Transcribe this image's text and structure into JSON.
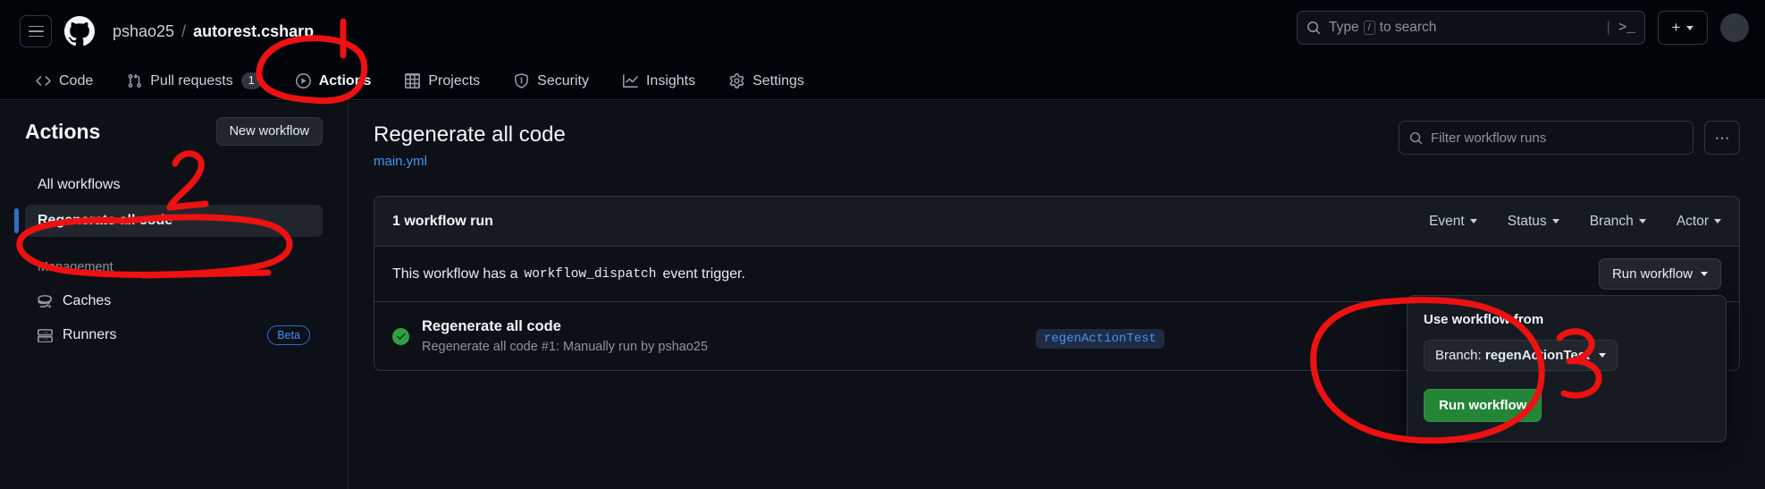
{
  "header": {
    "menu_icon": "hamburger-icon",
    "logo_icon": "github-logo-icon",
    "owner": "pshao25",
    "separator": "/",
    "repo": "autorest.csharp",
    "search_placeholder": "Type",
    "search_key": "/",
    "search_suffix": "to search",
    "terminal_icon": "terminal-icon",
    "plus_label": "+",
    "avatar": "user-avatar"
  },
  "repo_nav": [
    {
      "label": "Code",
      "icon": "code-icon",
      "active": false,
      "count": null
    },
    {
      "label": "Pull requests",
      "icon": "git-pull-request-icon",
      "active": false,
      "count": "1"
    },
    {
      "label": "Actions",
      "icon": "play-circle-icon",
      "active": true,
      "count": null
    },
    {
      "label": "Projects",
      "icon": "table-icon",
      "active": false,
      "count": null
    },
    {
      "label": "Security",
      "icon": "shield-icon",
      "active": false,
      "count": null
    },
    {
      "label": "Insights",
      "icon": "graph-icon",
      "active": false,
      "count": null
    },
    {
      "label": "Settings",
      "icon": "gear-icon",
      "active": false,
      "count": null
    }
  ],
  "sidebar": {
    "title": "Actions",
    "new_workflow_label": "New workflow",
    "all_workflows_label": "All workflows",
    "selected_workflow_label": "Regenerate all code",
    "management_label": "Management",
    "caches_label": "Caches",
    "caches_icon": "cache-icon",
    "runners_label": "Runners",
    "runners_icon": "server-icon",
    "runners_badge": "Beta"
  },
  "main": {
    "workflow_title": "Regenerate all code",
    "workflow_file": "main.yml",
    "filter_placeholder": "Filter workflow runs",
    "search_icon": "search-icon",
    "more_options_label": "···",
    "runs_count_label": "1 workflow run",
    "filters": [
      {
        "label": "Event"
      },
      {
        "label": "Status"
      },
      {
        "label": "Branch"
      },
      {
        "label": "Actor"
      }
    ],
    "dispatch_prefix": "This workflow has a",
    "dispatch_code": "workflow_dispatch",
    "dispatch_suffix": "event trigger.",
    "run_workflow_button": "Run workflow",
    "run": {
      "status_icon": "check-circle-icon",
      "name": "Regenerate all code",
      "meta": "Regenerate all code #1: Manually run by pshao25",
      "branch_tag": "regenActionTest"
    },
    "panel": {
      "title": "Use workflow from",
      "branch_prefix": "Branch:",
      "branch_name": "regenActionTest",
      "run_button": "Run workflow"
    }
  },
  "annotations": {
    "color": "#ee1111",
    "marks": [
      {
        "label": "1",
        "target": "actions-tab"
      },
      {
        "label": "2",
        "target": "sidebar-workflow"
      },
      {
        "label": "3",
        "target": "run-workflow-panel"
      }
    ]
  },
  "colors": {
    "page_bg": "#0d1117",
    "chrome_bg": "#010409",
    "border": "#30363d",
    "accent_blue": "#4493f8",
    "success_green": "#2ea043",
    "button_green": "#238636",
    "annotation_red": "#ee1111"
  }
}
